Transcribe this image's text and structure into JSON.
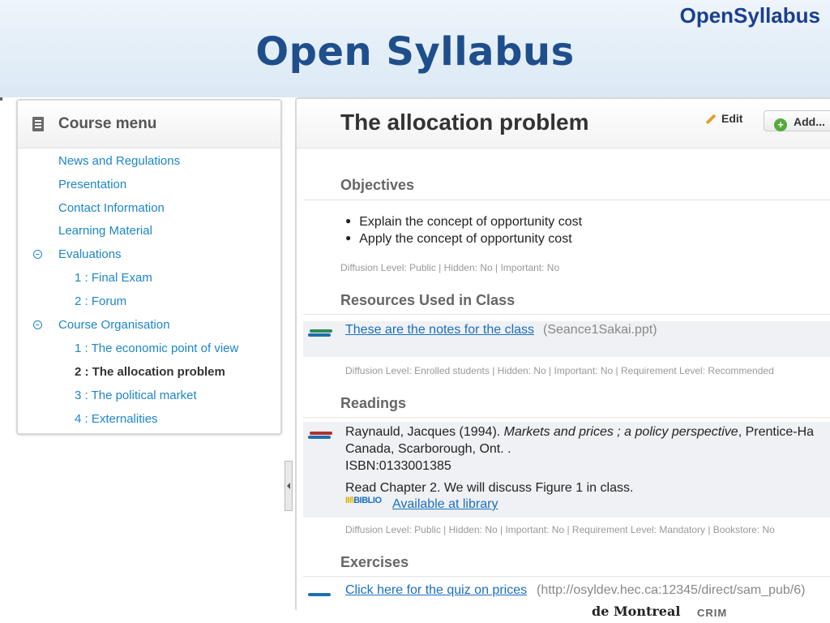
{
  "slide": {
    "title": "Open Syllabus",
    "brand": "OpenSyllabus",
    "footer_text": "de Montreal",
    "footer_logo": "CRIM"
  },
  "colors": {
    "title": "#1f4e8c",
    "link": "#1a6fbf",
    "menu_link": "#1d86c7",
    "banner": "#dbe8f4"
  },
  "menu": {
    "title": "Course menu",
    "icon": "list-icon",
    "items": [
      {
        "label": "News and Regulations"
      },
      {
        "label": "Presentation"
      },
      {
        "label": "Contact Information"
      },
      {
        "label": "Learning Material"
      },
      {
        "label": "Evaluations",
        "expanded": true
      },
      {
        "label": "1 : Final Exam"
      },
      {
        "label": "2 : Forum"
      },
      {
        "label": "Course Organisation",
        "expanded": true
      },
      {
        "label": "1 : The economic point of view"
      },
      {
        "label": "2 : The allocation problem",
        "active": true
      },
      {
        "label": "3 : The political market"
      },
      {
        "label": "4 : Externalities"
      }
    ]
  },
  "content": {
    "title": "The allocation problem",
    "edit_label": "Edit",
    "add_label": "Add...",
    "objectives": {
      "title": "Objectives",
      "bullets": [
        "Explain the concept of opportunity cost",
        "Apply the concept of opportunity cost"
      ],
      "meta": "Diffusion Level: Public | Hidden: No | Important: No"
    },
    "resources": {
      "title": "Resources Used in Class",
      "link": "These are the notes for the class",
      "file": "(Seance1Sakai.ppt)",
      "meta": "Diffusion Level: Enrolled students | Hidden: No | Important: No | Requirement Level: Recommended"
    },
    "readings": {
      "title": "Readings",
      "citation_author": "Raynauld, Jacques (1994). ",
      "citation_title": "Markets and prices ; a policy perspective",
      "citation_publisher": ", Prentice-Ha",
      "citation_line2": "Canada, Scarborough, Ont. .",
      "isbn": "ISBN:0133001385",
      "note": "Read Chapter 2.  We will discuss Figure 1 in class.",
      "biblio_logo": "BIBLIO",
      "library_link": "Available at library",
      "meta": "Diffusion Level: Public | Hidden: No | Important: No | Requirement Level: Mandatory | Bookstore: No"
    },
    "exercises": {
      "title": "Exercises",
      "link": "Click here for the quiz on prices",
      "url": "(http://osyldev.hec.ca:12345/direct/sam_pub/6)"
    }
  }
}
